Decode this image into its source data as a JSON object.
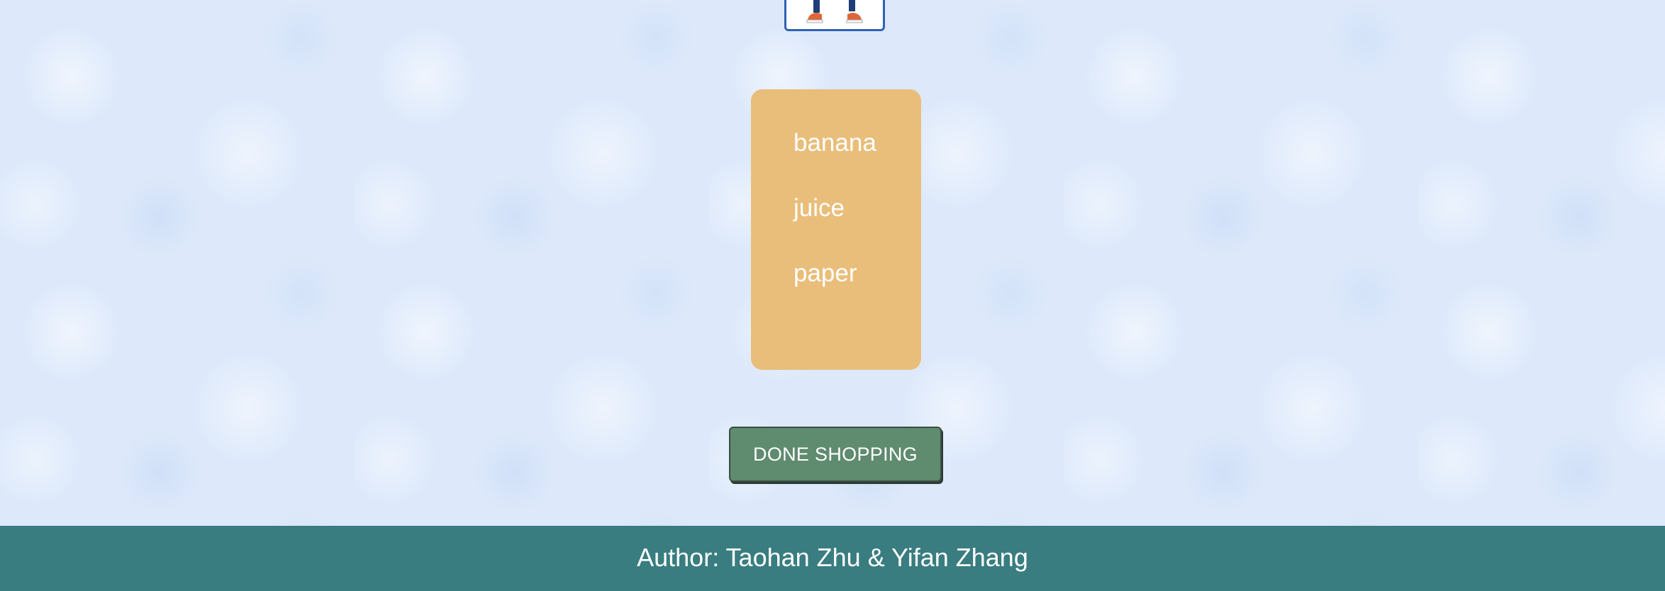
{
  "avatar": {
    "icon": "character-legs-icon"
  },
  "shopping_list": {
    "items": [
      {
        "label": "banana"
      },
      {
        "label": "juice"
      },
      {
        "label": "paper"
      }
    ]
  },
  "done_button": {
    "label": "DONE SHOPPING"
  },
  "footer": {
    "author_text": "Author: Taohan Zhu & Yifan Zhang"
  },
  "colors": {
    "background": "#dde9fb",
    "list_card": "#e9be7a",
    "button": "#5f8b6f",
    "footer": "#397d80",
    "avatar_border": "#2f62b5"
  }
}
